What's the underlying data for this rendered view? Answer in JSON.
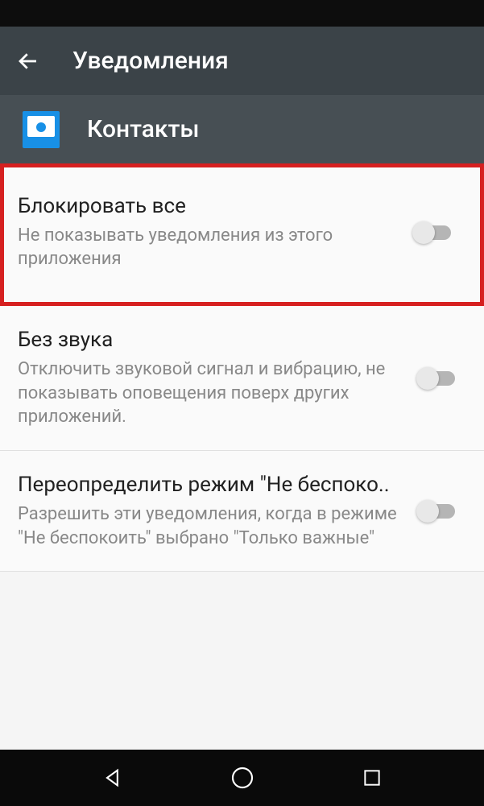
{
  "header": {
    "title": "Уведомления"
  },
  "subheader": {
    "app_name": "Контакты"
  },
  "settings": [
    {
      "title": "Блокировать все",
      "desc": "Не показывать уведомления из этого приложения",
      "highlighted": true
    },
    {
      "title": "Без звука",
      "desc": "Отключить звуковой сигнал и вибрацию, не показывать оповещения поверх других приложений.",
      "highlighted": false
    },
    {
      "title": "Переопределить режим \"Не беспоко..",
      "desc": "Разрешить эти уведомления, когда в режиме \"Не беспокоить\" выбрано \"Только важные\"",
      "highlighted": false
    }
  ]
}
